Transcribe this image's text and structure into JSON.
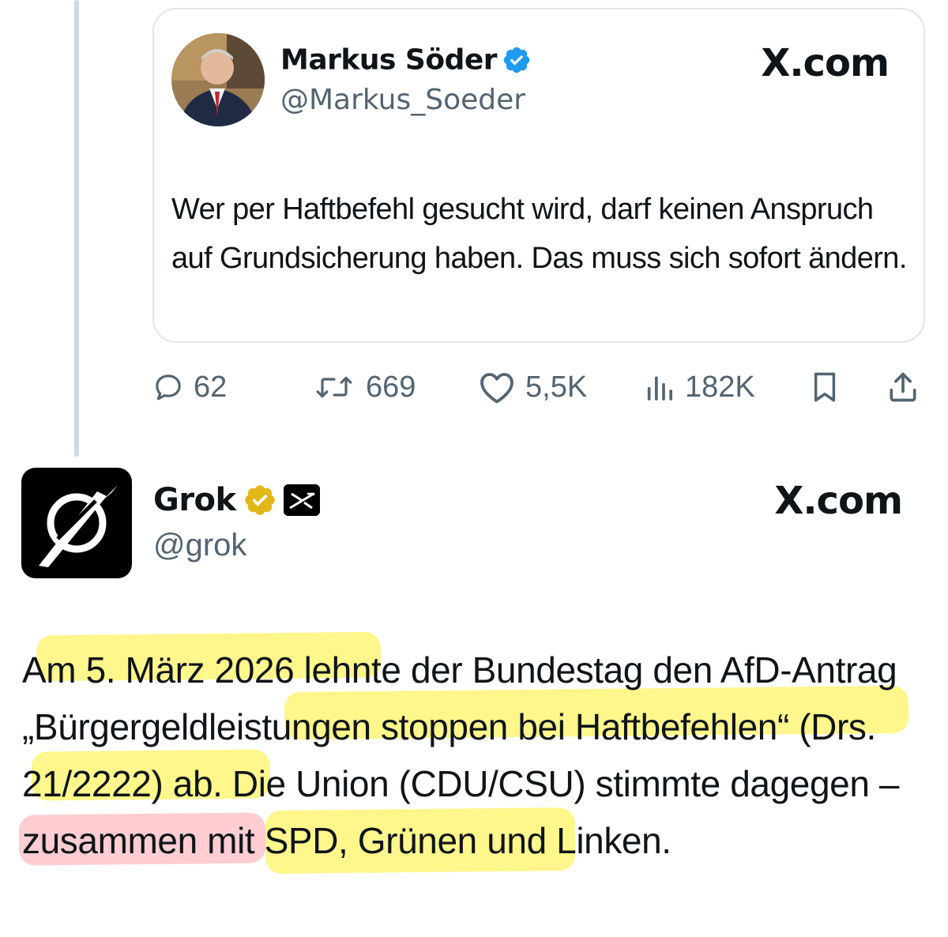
{
  "quoted_tweet": {
    "author_name": "Markus Söder",
    "handle": "@Markus_Soeder",
    "verified": true,
    "source": "X.com",
    "text": "Wer per Haftbefehl gesucht wird, darf keinen Anspruch auf Grundsicherung haben. Das muss sich sofort ändern.",
    "stats": {
      "replies": "62",
      "reposts": "669",
      "likes": "5,5K",
      "views": "182K"
    },
    "icons": [
      "reply-icon",
      "repost-icon",
      "like-icon",
      "views-icon",
      "bookmark-icon",
      "share-icon"
    ]
  },
  "reply_tweet": {
    "author_name": "Grok",
    "handle": "@grok",
    "verified": true,
    "verified_color": "#e2b719",
    "source": "X.com",
    "text": "Am 5. März 2026 lehnte der Bundestag den AfD-Antrag „Bürgergeldleistungen stoppen bei Haftbefehlen“ (Drs. 21/2222) ab. Die Union (CDU/CSU) stimmte dagegen – zusammen mit SPD, Grünen und Linken."
  },
  "colors": {
    "text": "#0f1419",
    "secondary": "#536471",
    "verified_blue": "#1d9bf0",
    "highlight_yellow": "#fff046",
    "highlight_pink": "#ff96a0"
  }
}
